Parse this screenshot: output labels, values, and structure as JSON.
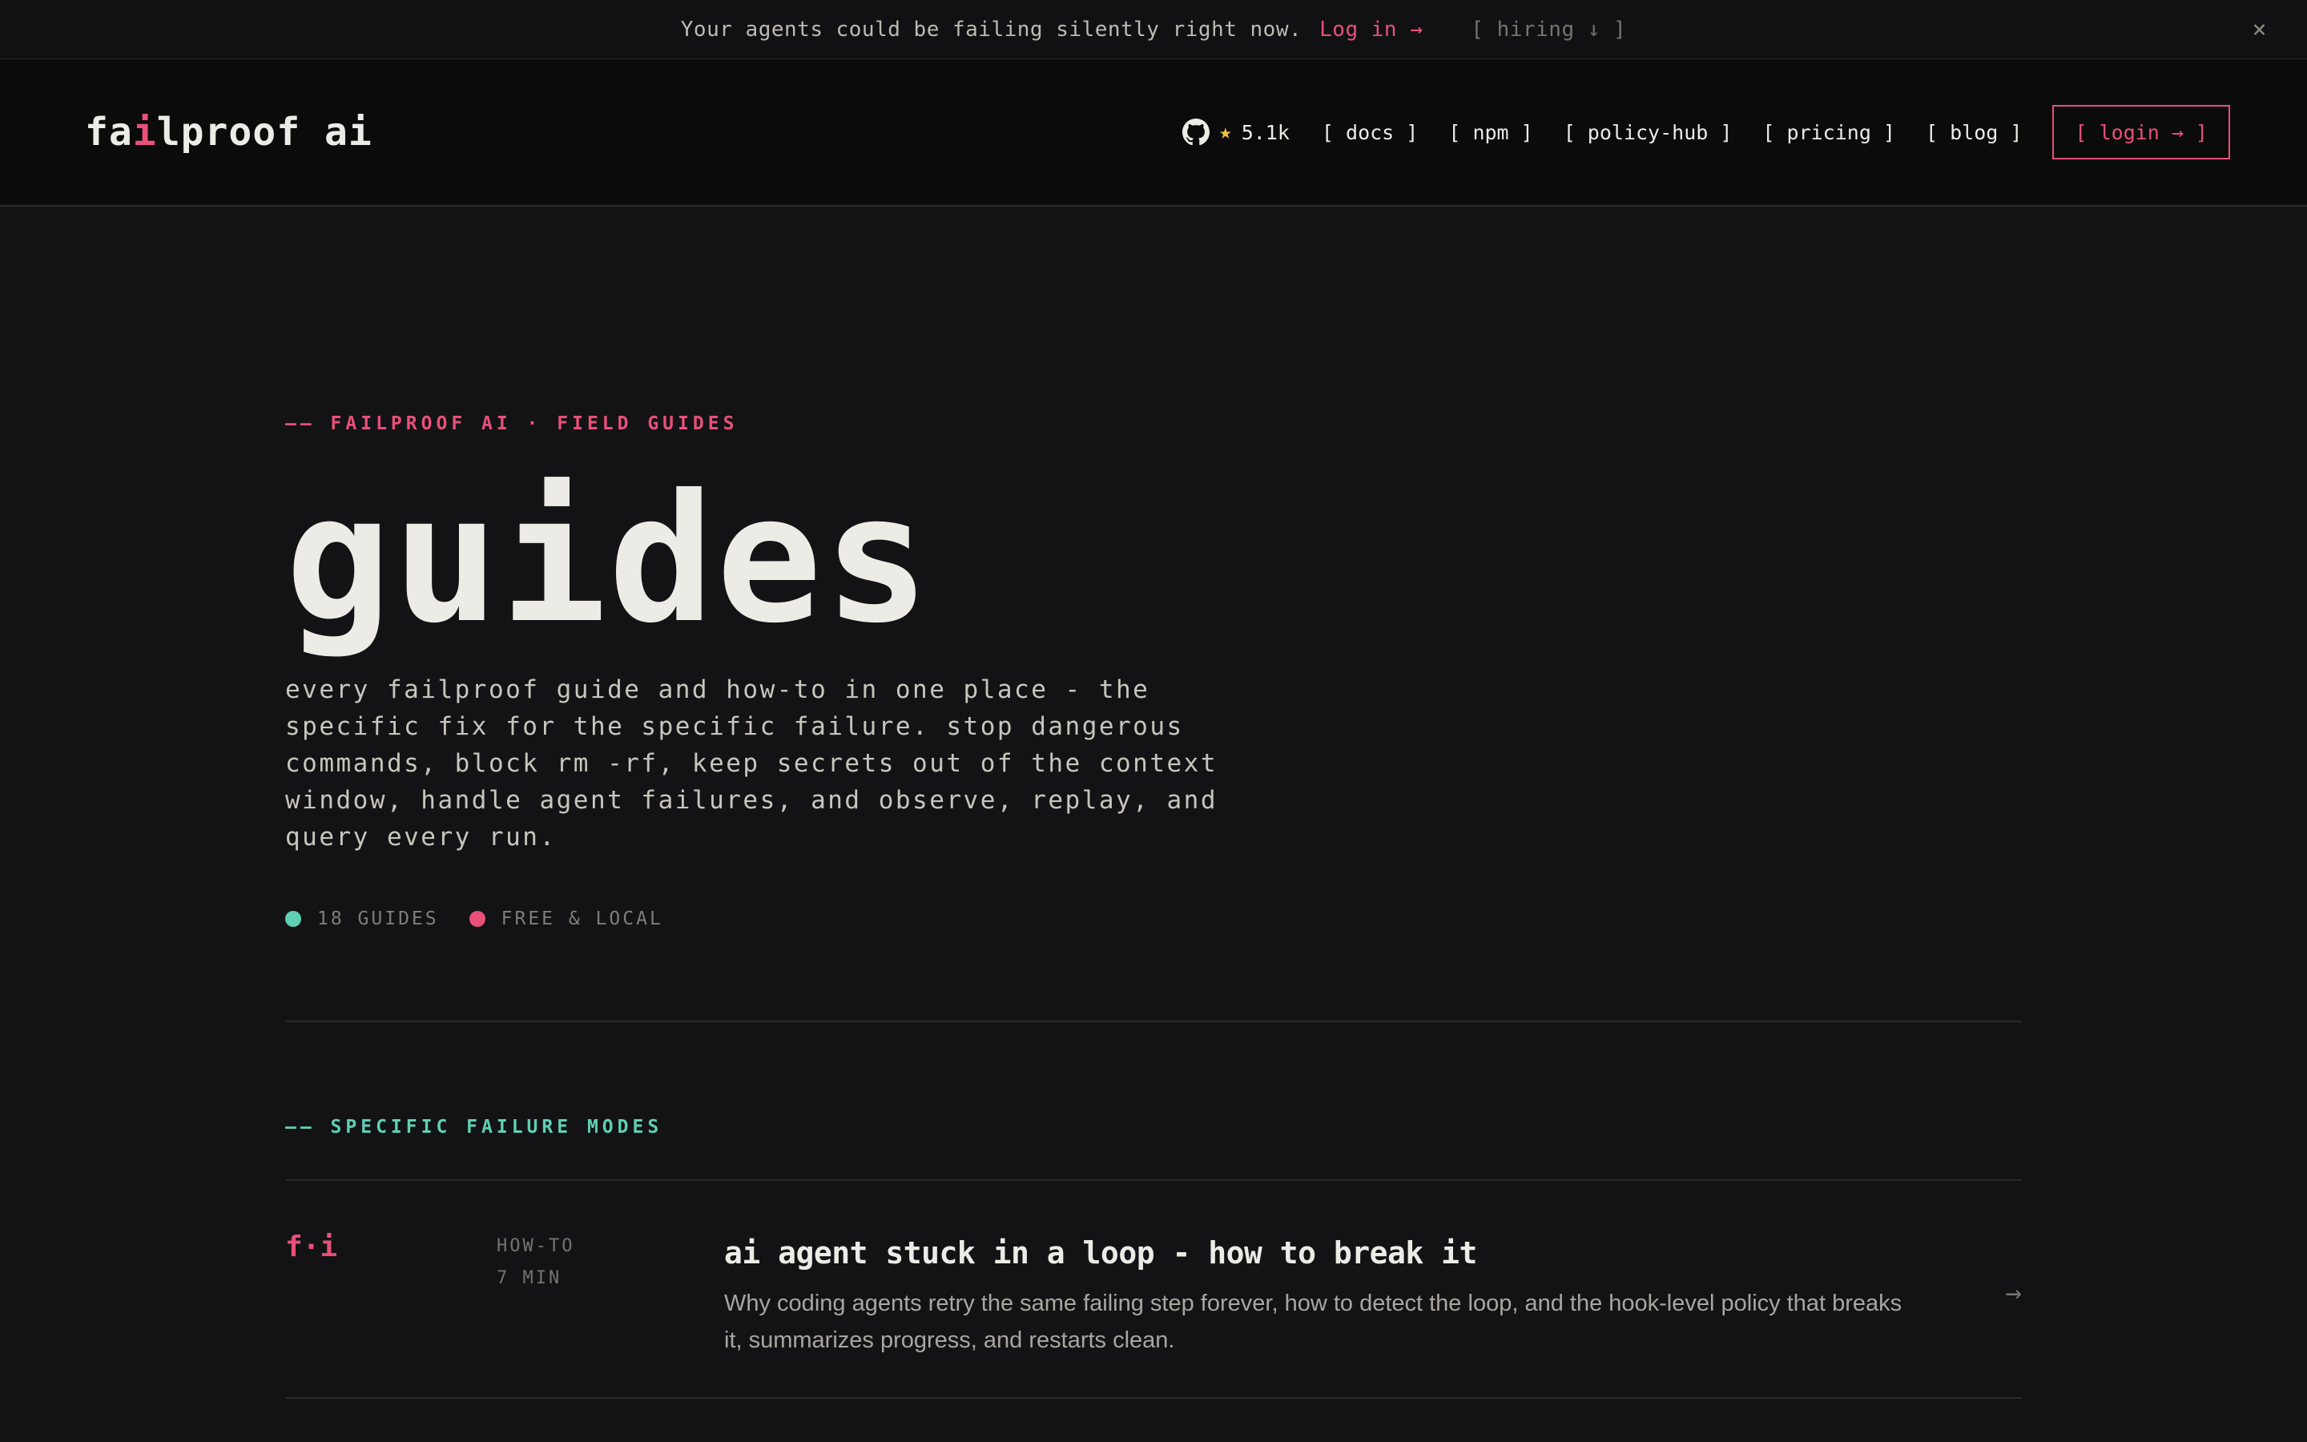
{
  "announcement": {
    "message": "Your agents could be failing silently right now.",
    "login_link": "Log in →",
    "hiring": "[ hiring ↓ ]",
    "close_icon": "×"
  },
  "header": {
    "logo_pre": "fa",
    "logo_accent": "i",
    "logo_post": "lproof ai",
    "github_stars": "5.1k",
    "star_glyph": "★",
    "nav": {
      "docs": "[ docs ]",
      "npm": "[ npm ]",
      "policy_hub": "[ policy-hub ]",
      "pricing": "[ pricing ]",
      "blog": "[ blog ]",
      "login": "[ login → ]"
    }
  },
  "hero": {
    "eyebrow": "—— FAILPROOF AI · FIELD GUIDES",
    "title": "guides",
    "description": "every failproof guide and how-to in one place - the specific fix for the specific failure. stop dangerous commands, block rm -rf, keep secrets out of the context window, handle agent failures, and observe, replay, and query every run.",
    "badges": {
      "count": "18 GUIDES",
      "free": "FREE & LOCAL"
    }
  },
  "section": {
    "eyebrow": "—— SPECIFIC FAILURE MODES"
  },
  "guides": [
    {
      "icon": "f·i",
      "kind": "HOW-TO",
      "read_time": "7 MIN",
      "title": "ai agent stuck in a loop - how to break it",
      "description": "Why coding agents retry the same failing step forever, how to detect the loop, and the hook-level policy that breaks it, summarizes progress, and restarts clean.",
      "arrow": "→"
    }
  ],
  "colors": {
    "accent_pink": "#e8507a",
    "accent_teal": "#5fd0b4",
    "star_yellow": "#f3c443",
    "background": "#131315"
  }
}
